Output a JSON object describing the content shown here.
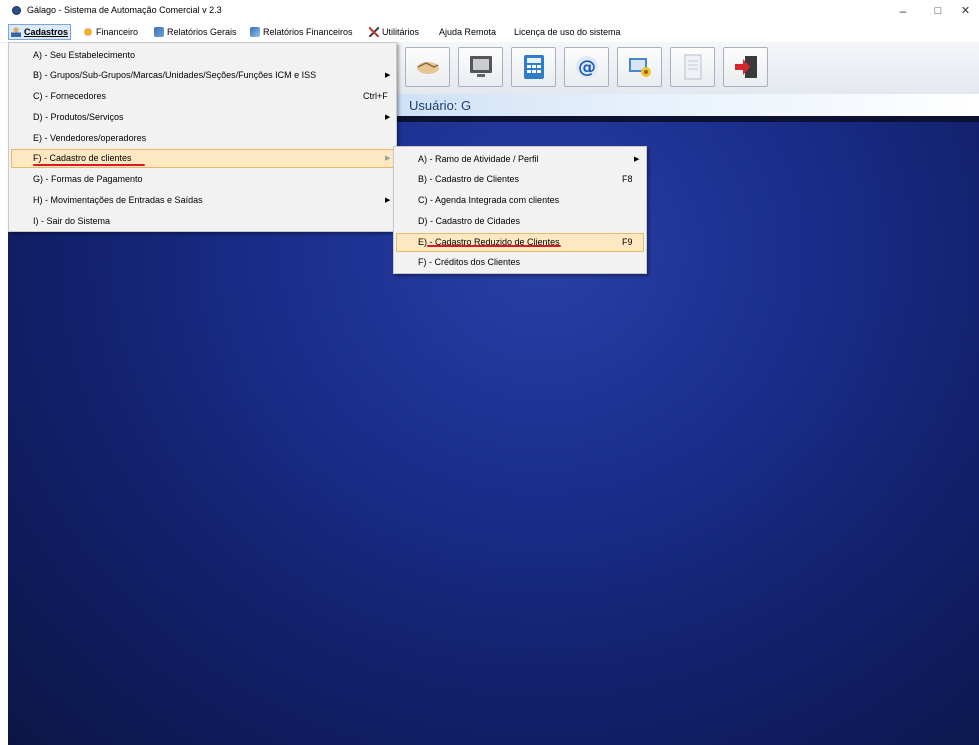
{
  "window": {
    "title": "Gálago - Sistema de Automação Comercial v 2.3",
    "minimize": "–",
    "maximize": "□",
    "close": "✕"
  },
  "menubar": {
    "items": [
      {
        "label": "Cadastros",
        "icon": "person-icon"
      },
      {
        "label": "Financeiro",
        "icon": "coins-icon"
      },
      {
        "label": "Relatórios Gerais",
        "icon": "report-icon"
      },
      {
        "label": "Relatórios Financeiros",
        "icon": "money-report-icon"
      },
      {
        "label": "Utilitários",
        "icon": "tools-icon"
      },
      {
        "label": "Ajuda Remota"
      },
      {
        "label": "Licença de uso do sistema"
      }
    ]
  },
  "toolbar": {
    "buttons": [
      {
        "icon": "handshake-icon"
      },
      {
        "icon": "monitor-icon"
      },
      {
        "icon": "calculator-icon"
      },
      {
        "icon": "email-at-icon"
      },
      {
        "icon": "key-folder-icon"
      },
      {
        "icon": "document-icon"
      },
      {
        "icon": "exit-door-icon"
      }
    ]
  },
  "user": {
    "label": "Usuário:  G"
  },
  "cadastros_menu": {
    "items": [
      {
        "label": "A) - Seu Estabelecimento",
        "shortcut": "",
        "submenu": false
      },
      {
        "label": "B) - Grupos/Sub-Grupos/Marcas/Unidades/Seções/Funções ICM e ISS",
        "shortcut": "",
        "submenu": true
      },
      {
        "label": "C) - Fornecedores",
        "shortcut": "Ctrl+F",
        "submenu": false
      },
      {
        "label": "D) - Produtos/Serviços",
        "shortcut": "",
        "submenu": true
      },
      {
        "label": "E) - Vendedores/operadores",
        "shortcut": "",
        "submenu": false
      },
      {
        "label": "F) - Cadastro de clientes",
        "shortcut": "",
        "submenu": true,
        "highlighted": true
      },
      {
        "label": "G) - Formas de Pagamento",
        "shortcut": "",
        "submenu": false
      },
      {
        "label": "H) - Movimentações de Entradas e Saídas",
        "shortcut": "",
        "submenu": true
      },
      {
        "label": "I) - Sair do Sistema",
        "shortcut": "",
        "submenu": false
      }
    ]
  },
  "clientes_submenu": {
    "items": [
      {
        "label": "A) - Ramo de Atividade / Perfil",
        "shortcut": "",
        "submenu": true
      },
      {
        "label": "B) - Cadastro de Clientes",
        "shortcut": "F8",
        "submenu": false
      },
      {
        "label": "C) - Agenda Integrada com clientes",
        "shortcut": "",
        "submenu": false
      },
      {
        "label": "D) - Cadastro de Cidades",
        "shortcut": "",
        "submenu": false
      },
      {
        "label": "E) - Cadastro Reduzido de Clientes",
        "shortcut": "F9",
        "submenu": false,
        "highlighted": true
      },
      {
        "label": "F) - Créditos dos Clientes",
        "shortcut": "",
        "submenu": false
      }
    ]
  },
  "colors": {
    "desktop": "#1a2d8a",
    "highlight": "#fde8c2",
    "annotation_underline": "#d7192a"
  }
}
